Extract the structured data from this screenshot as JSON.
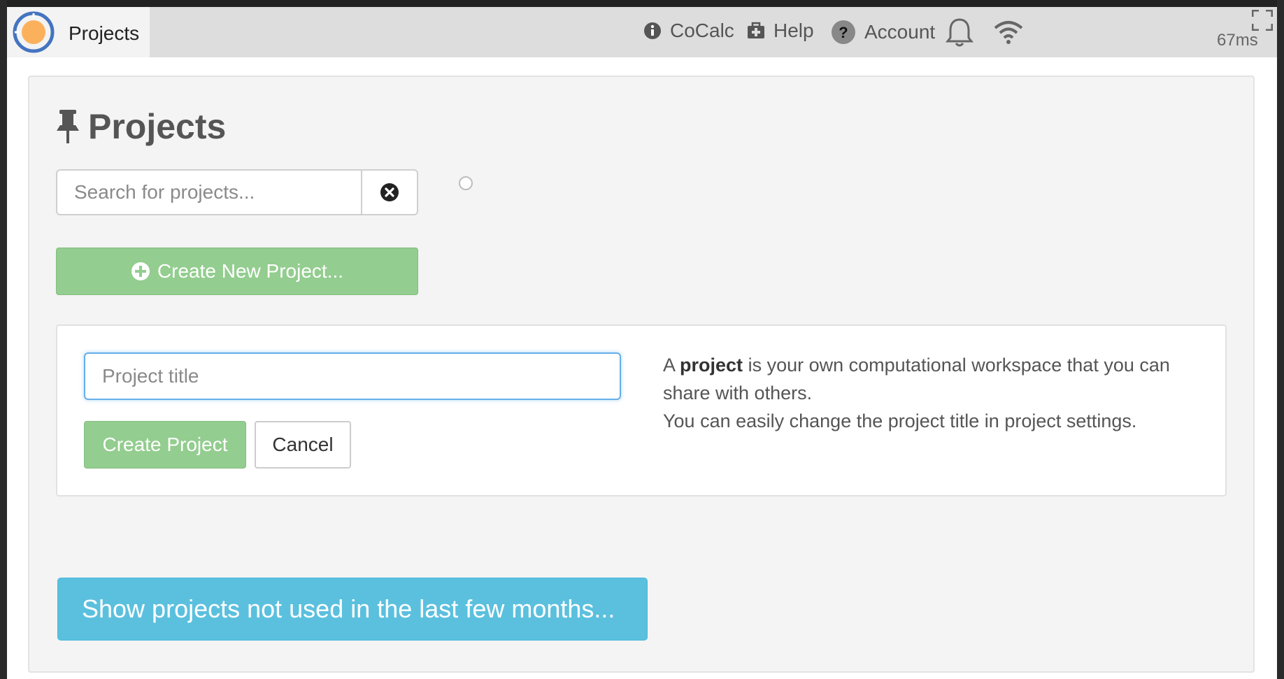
{
  "topbar": {
    "tab_label": "Projects",
    "nav": {
      "cocalc": "CoCalc",
      "help": "Help",
      "account": "Account"
    },
    "ping": "67ms",
    "icons": [
      "info-circle-icon",
      "medkit-icon",
      "question-circle-icon",
      "bell-icon",
      "wifi-icon",
      "fullscreen-icon"
    ]
  },
  "main": {
    "title": "Projects",
    "search": {
      "placeholder": "Search for projects...",
      "value": ""
    },
    "create_new_label": "Create New Project...",
    "create_form": {
      "title_placeholder": "Project title",
      "create_label": "Create Project",
      "cancel_label": "Cancel",
      "desc_prefix": "A ",
      "desc_bold": "project",
      "desc_rest": " is your own computational workspace that you can share with others.",
      "desc_line2": "You can easily change the project title in project settings."
    },
    "show_old_label": "Show projects not used in the last few months..."
  },
  "colors": {
    "success": "#93cd8f",
    "info": "#5bc0de",
    "focus": "#66afe9",
    "logo_ring": "#4474c0",
    "logo_sun": "#fbb15c"
  }
}
